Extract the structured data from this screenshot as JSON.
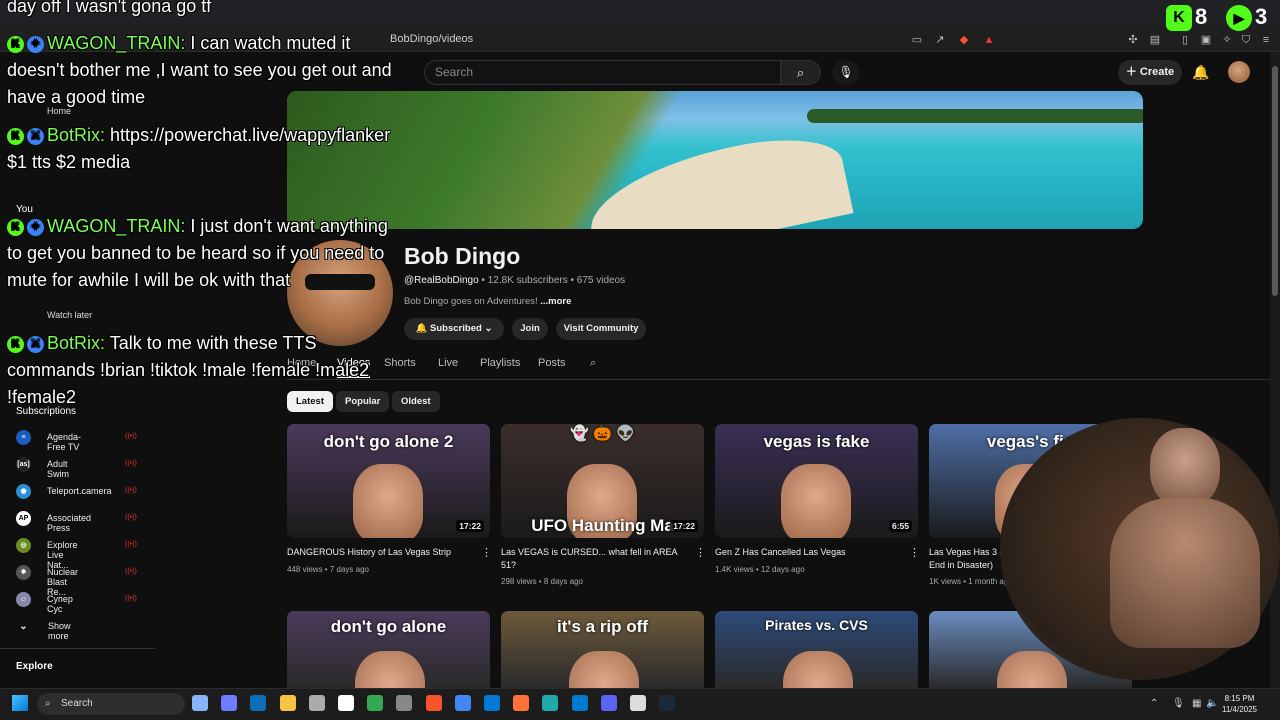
{
  "overlay_top": {
    "text": "day off I wasn't gona go tf"
  },
  "kick_counts": {
    "followers": "8",
    "viewers": "3"
  },
  "browser": {
    "url": "BobDingo/videos"
  },
  "yt": {
    "search_placeholder": "Search",
    "create_label": "Create"
  },
  "sidebar": {
    "home": "Home",
    "you": "You",
    "watch_later": "Watch later",
    "subscriptions_title": "Subscriptions",
    "subs": [
      {
        "name": "Agenda-Free TV",
        "color": "#1a5fbf",
        "glyph": "≡"
      },
      {
        "name": "Adult Swim",
        "color": "#222",
        "glyph": "[as]"
      },
      {
        "name": "Teleport.camera",
        "color": "#2b8fd0",
        "glyph": "◉"
      },
      {
        "name": "Associated Press",
        "color": "#fff",
        "glyph": "AP"
      },
      {
        "name": "Explore Live Nat...",
        "color": "#6b8e23",
        "glyph": "◎"
      },
      {
        "name": "Nuclear Blast Re...",
        "color": "#555",
        "glyph": "✸"
      },
      {
        "name": "Супер Сус",
        "color": "#88a",
        "glyph": "☺"
      }
    ],
    "show_more": "Show more",
    "explore": "Explore"
  },
  "channel": {
    "name": "Bob Dingo",
    "handle": "@RealBobDingo",
    "stats": "12.8K subscribers • 675 videos",
    "desc": "Bob Dingo goes on Adventures!",
    "desc_more": "...more",
    "subscribed": "Subscribed",
    "join": "Join",
    "visit": "Visit Community"
  },
  "tabs": [
    "Home",
    "Videos",
    "Shorts",
    "Live",
    "Playlists",
    "Posts"
  ],
  "chips": [
    "Latest",
    "Popular",
    "Oldest"
  ],
  "videos_row1": [
    {
      "thumb_text": "don't go alone 2",
      "duration": "17:22",
      "title": "DANGEROUS History of Las Vegas Strip",
      "meta": "448 views • 7 days ago",
      "bg": "#4a3a5a"
    },
    {
      "thumb_text": "UFO  Haunting  Ma",
      "duration": "17:22",
      "title": "Las VEGAS is CURSED... what fell in AREA 51?",
      "meta": "298 views • 8 days ago",
      "bg": "#3b2e2a",
      "emoji": "👻 🎃 👽"
    },
    {
      "thumb_text": "vegas is fake",
      "duration": "6:55",
      "title": "Gen Z Has Cancelled Las Vegas",
      "meta": "1.4K views • 12 days ago",
      "bg": "#3a2f55"
    },
    {
      "thumb_text": "vegas's fin",
      "duration": "",
      "title": "Las Vegas Has 3 Future",
      "title2": "End in Disaster)",
      "meta": "1K views • 1 month ago",
      "bg": "#4f6fa8"
    }
  ],
  "videos_row2": [
    {
      "thumb_text": "don't go alone",
      "bg": "#4a3a5a"
    },
    {
      "thumb_text": "it's a rip off",
      "bg": "#6d5a3b"
    },
    {
      "thumb_text": "Pirates vs. CVS",
      "bg": "#2d4a78"
    },
    {
      "thumb_text": "",
      "bg": "#6a8cc0"
    }
  ],
  "chat": [
    {
      "user": "WAGON_TRAIN:",
      "msg": "I can watch muted it doesn't bother me ,I want to see you get out and have a good time"
    },
    {
      "user": "BotRix:",
      "msg": "https://powerchat.live/wappyflanker $1 tts $2 media"
    },
    {
      "user": "WAGON_TRAIN:",
      "msg": "I just don't want anything to get you banned to be heard so if you need to mute for awhile I will be ok with that"
    },
    {
      "user": "BotRix:",
      "msg": "Talk to me with these TTS commands !brian !tiktok !male !female !male2 !female2"
    }
  ],
  "taskbar": {
    "search": "Search",
    "time": "8:15 PM",
    "date": "11/4/2025"
  }
}
